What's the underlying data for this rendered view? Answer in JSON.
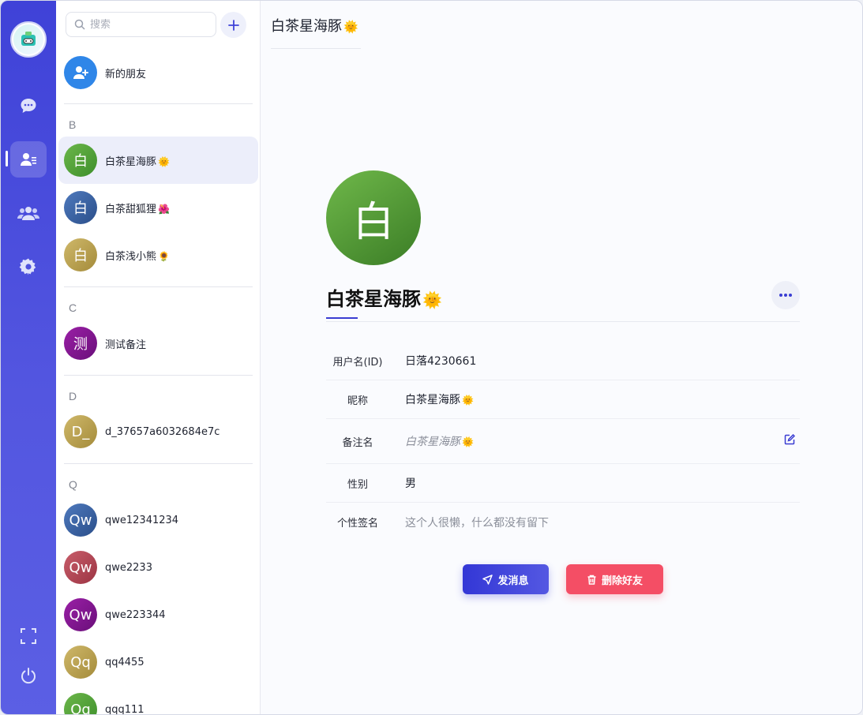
{
  "search": {
    "placeholder": "搜索"
  },
  "contacts": {
    "new_friend_label": "新的朋友",
    "groups": [
      {
        "letter": "B",
        "items": [
          {
            "avatar": "白",
            "name": "白茶星海豚",
            "emoji": "🌞"
          },
          {
            "avatar": "白",
            "name": "白茶甜狐狸",
            "emoji": "🌺"
          },
          {
            "avatar": "白",
            "name": "白茶浅小熊",
            "emoji": "🌻"
          }
        ]
      },
      {
        "letter": "C",
        "items": [
          {
            "avatar": "测",
            "name": "测试备注",
            "emoji": ""
          }
        ]
      },
      {
        "letter": "D",
        "items": [
          {
            "avatar": "D_",
            "name": "d_37657a6032684e7c",
            "emoji": ""
          }
        ]
      },
      {
        "letter": "Q",
        "items": [
          {
            "avatar": "Qw",
            "name": "qwe12341234",
            "emoji": ""
          },
          {
            "avatar": "Qw",
            "name": "qwe2233",
            "emoji": ""
          },
          {
            "avatar": "Qw",
            "name": "qwe223344",
            "emoji": ""
          },
          {
            "avatar": "Qq",
            "name": "qq4455",
            "emoji": ""
          },
          {
            "avatar": "Qq",
            "name": "qqq111",
            "emoji": ""
          }
        ]
      }
    ]
  },
  "detail": {
    "title": "白茶星海豚",
    "title_emoji": "🌞",
    "avatar": "白",
    "name": "白茶星海豚",
    "name_emoji": "🌞",
    "fields": [
      {
        "key": "用户名(ID)",
        "value": "日落4230661"
      },
      {
        "key": "昵称",
        "value": "白茶星海豚",
        "emoji": "🌞"
      },
      {
        "key": "备注名",
        "value": "白茶星海豚",
        "emoji": "🌞"
      },
      {
        "key": "性别",
        "value": "男"
      },
      {
        "key": "个性签名",
        "value": "这个人很懒，什么都没有留下"
      }
    ],
    "send_button": "发消息",
    "delete_button": "删除好友"
  },
  "colors": {
    "accent": "#3f42d8",
    "danger": "#f44e65",
    "new_friend_avatar": "#2f86e8"
  }
}
